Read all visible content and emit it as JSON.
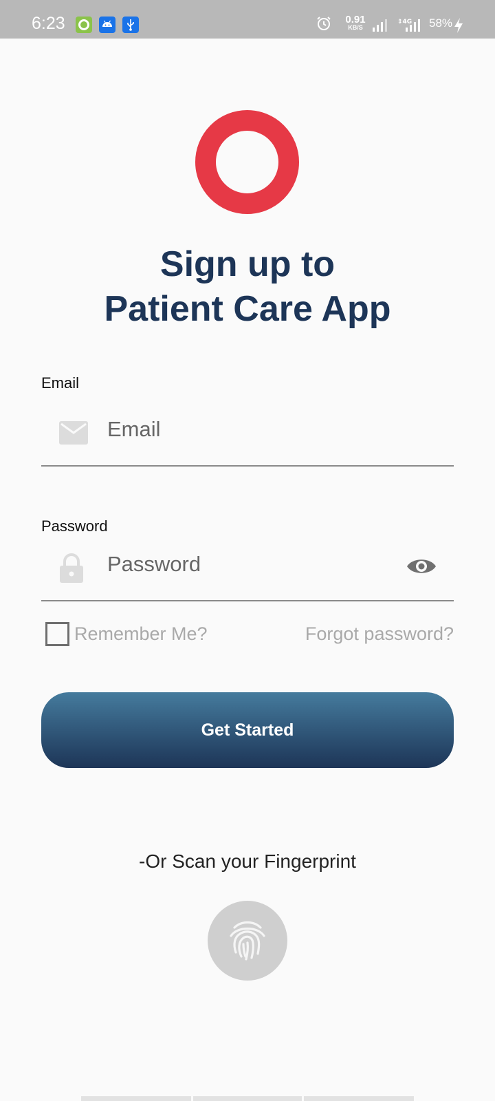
{
  "status_bar": {
    "time": "6:23",
    "speed_value": "0.91",
    "speed_unit": "KB/S",
    "network": "4G",
    "battery": "58%",
    "icons": [
      "app-green-icon",
      "android-icon",
      "usb-icon",
      "alarm-icon",
      "signal-icon",
      "battery-charging-icon"
    ]
  },
  "brand": {
    "logo": "ring-logo",
    "color": "#e63946"
  },
  "title": {
    "line1": "Sign up to",
    "line2": "Patient Care App",
    "color": "#1d3557"
  },
  "form": {
    "email": {
      "label": "Email",
      "placeholder": "Email",
      "value": ""
    },
    "password": {
      "label": "Password",
      "placeholder": "Password",
      "value": ""
    },
    "remember_label": "Remember Me?",
    "remember_checked": false,
    "forgot_label": "Forgot password?",
    "submit_label": "Get Started",
    "button_gradient": [
      "#457b9d",
      "#1d3557"
    ]
  },
  "alt_login": {
    "text": "-Or Scan your Fingerprint",
    "icon": "fingerprint-icon"
  }
}
